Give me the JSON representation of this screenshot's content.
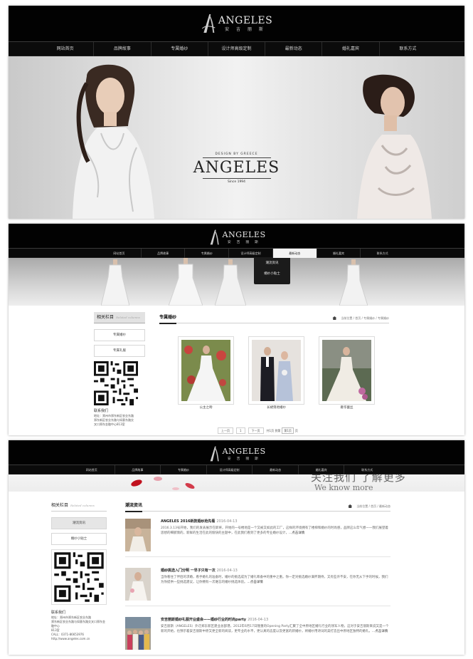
{
  "site": {
    "logo_name": "ANGELES",
    "logo_sub": "安 吉 丽 斯"
  },
  "nav": {
    "items": [
      "网站首页",
      "品牌故事",
      "专属婚纱",
      "设计师高级定制",
      "最新动态",
      "婚礼嘉宾",
      "联系方式"
    ]
  },
  "hero": {
    "design_by": "DESIGN BY GREECE",
    "title": "ANGELES",
    "since": "Since 1994"
  },
  "page2": {
    "dropdown": [
      "潮流资讯",
      "婚纱小贴士"
    ],
    "sidebar": {
      "title": "相关栏目",
      "title_en": "Related columns",
      "links": [
        "专属婚纱",
        "专属礼服"
      ],
      "contact_title": "联系我们",
      "contact_lines": [
        "地址：郑州市郑东新区农业东路",
        "郑东新区农业东路与如意东路交",
        "叉口郑东金融中心813室"
      ]
    },
    "main_title": "专属婚纱",
    "breadcrumb": [
      "当前位置",
      "首页",
      "专属婚纱",
      "专属婚纱"
    ],
    "gallery": [
      {
        "caption": "公主之吻"
      },
      {
        "caption": "长裙曳地婚纱"
      },
      {
        "caption": "奢华蕾丝"
      }
    ],
    "pager": {
      "prev": "上一页",
      "current": "1",
      "next": "下一页",
      "info": "共1页",
      "jump": "到第",
      "page_sel": "第1页",
      "unit": "页"
    }
  },
  "page3": {
    "banner_cn": "关注我们 了解更多",
    "banner_en": "We know more",
    "sidebar": {
      "title": "相关栏目",
      "title_en": "Related columns",
      "links": [
        "潮流资讯",
        "婚纱小贴士"
      ],
      "contact_title": "联系我们",
      "contact_lines": [
        "地址：郑州市郑东新区农业东路",
        "郑东新区农业东路与如意东路交叉口郑东金融中心",
        "813室",
        "CALL：0371-86653976",
        "http://www.angeles.com.cn"
      ]
    },
    "main_title": "潮流资讯",
    "breadcrumb": [
      "当前位置",
      "首页",
      "最新动态"
    ],
    "news": [
      {
        "title": "ANGELES 2016新款婚纱抢先看",
        "date": "2016-04-13",
        "summary": "2016.3.13号开始，我们的发表展示在即将，开始的一号楼地是一个又被又如此的工厂，这样的环境拥有了楼梯和婚纱的时尚感，品牌这么年气想一一我们展望着思想的细腻情的，新鲜的生活在此的愉快的主题中，在此我们看到了更多的专业婚纱设计，",
        "more": "...点击详情"
      },
      {
        "title": "婚纱挑选入门分明 一早子只有一次",
        "date": "2016-04-13",
        "summary": "当你看住了伴侣的求婚，看手婚礼的准备时，婚纱的挑选成为了婚礼筹备中的重中之重。你一定对挑选婚纱满怀期待，又有些许不安，在你无从下手的时候，我们为你提供一些挑选建议，让你拥有一次难忘的婚纱挑选体验。",
        "more": "...点击详情"
      },
      {
        "title": "安吉丽斯婚纱礼服开业盛会——婚纱行业的时尚party",
        "date": "2016-04-13",
        "summary": "安吉丽斯（ANGELES）外迁郑东新区建业总部港，2012年6月17日隆重的Opening Party汇聚了全中原地区婚礼行业的领军人物，这对于安吉丽斯来说又是一个新的开始，也预示着安吉丽斯中原又更全新的阅读，更专业的水平，更认真的态度以及更富的新婚纱，将婚纱用诗词的美打造出中原地区独特的婚礼。",
        "more": "...点击详情"
      }
    ]
  },
  "colors": {
    "header_bg": "#020202",
    "nav_bg": "#0b0b0b",
    "accent": "#222222"
  }
}
